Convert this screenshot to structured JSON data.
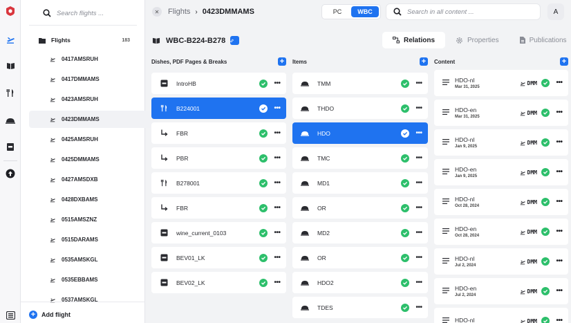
{
  "search": {
    "flights_placeholder": "Search flights ...",
    "all_placeholder": "Search in all content ..."
  },
  "sidebar": {
    "section_label": "Flights",
    "section_count": "183",
    "flights": [
      "0417AMSRUH",
      "0417DMMAMS",
      "0423AMSRUH",
      "0423DMMAMS",
      "0425AMSRUH",
      "0425DMMAMS",
      "0427AMSDXB",
      "0428DXBAMS",
      "0515AMSZNZ",
      "0515DARAMS",
      "0535AMSKGL",
      "0535EBBAMS",
      "0537AMSKGL"
    ],
    "selected_flight": "0423DMMAMS",
    "add_flight_label": "Add flight"
  },
  "header": {
    "breadcrumb_root": "Flights",
    "breadcrumb_current": "0423DMMAMS",
    "toggle": [
      "PC",
      "WBC"
    ],
    "toggle_active": "WBC",
    "avatar_initial": "A"
  },
  "entity": {
    "title": "WBC-B224-B278",
    "tabs": [
      "Relations",
      "Properties",
      "Publications"
    ],
    "active_tab": "Relations"
  },
  "columns": {
    "dishes": {
      "title": "Dishes, PDF Pages & Breaks",
      "items": [
        {
          "label": "IntroHB",
          "icon": "pdf-page-icon"
        },
        {
          "label": "B224001",
          "icon": "fork-knife-icon",
          "selected": true
        },
        {
          "label": "FBR",
          "icon": "break-arrow-icon"
        },
        {
          "label": "PBR",
          "icon": "break-arrow-icon"
        },
        {
          "label": "B278001",
          "icon": "fork-knife-icon"
        },
        {
          "label": "FBR",
          "icon": "break-arrow-icon"
        },
        {
          "label": "wine_current_0103",
          "icon": "pdf-page-icon"
        },
        {
          "label": "BEV01_LK",
          "icon": "pdf-page-icon"
        },
        {
          "label": "BEV02_LK",
          "icon": "pdf-page-icon"
        }
      ]
    },
    "items": {
      "title": "Items",
      "items": [
        {
          "label": "TMM"
        },
        {
          "label": "THDO"
        },
        {
          "label": "HDO",
          "selected": true
        },
        {
          "label": "TMC"
        },
        {
          "label": "MD1"
        },
        {
          "label": "OR"
        },
        {
          "label": "MD2"
        },
        {
          "label": "OR"
        },
        {
          "label": "HDO2"
        },
        {
          "label": "TDES"
        }
      ]
    },
    "content": {
      "title": "Content",
      "tag": "DMM",
      "items": [
        {
          "title": "HDO-nl",
          "date": "Mar 31, 2025"
        },
        {
          "title": "HDO-en",
          "date": "Mar 31, 2025"
        },
        {
          "title": "HDO-nl",
          "date": "Jan 9, 2025"
        },
        {
          "title": "HDO-en",
          "date": "Jan 9, 2025"
        },
        {
          "title": "HDO-nl",
          "date": "Oct 28, 2024"
        },
        {
          "title": "HDO-en",
          "date": "Oct 28, 2024"
        },
        {
          "title": "HDO-nl",
          "date": "Jul 2, 2024"
        },
        {
          "title": "HDO-en",
          "date": "Jul 2, 2024"
        },
        {
          "title": "HDO-nl",
          "date": ""
        }
      ]
    }
  },
  "colors": {
    "accent": "#1f73f0",
    "ok": "#2dbf6b",
    "logo": "#d9363e"
  }
}
